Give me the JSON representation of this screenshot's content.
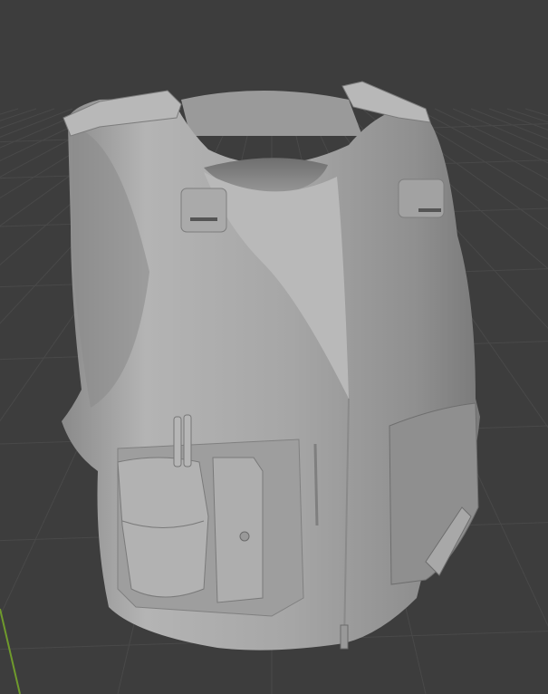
{
  "viewport": {
    "background_color": "#3d3d3d",
    "grid_color": "#494949",
    "y_axis_color": "#6f9a2c",
    "model_color": "#a3a3a3"
  }
}
